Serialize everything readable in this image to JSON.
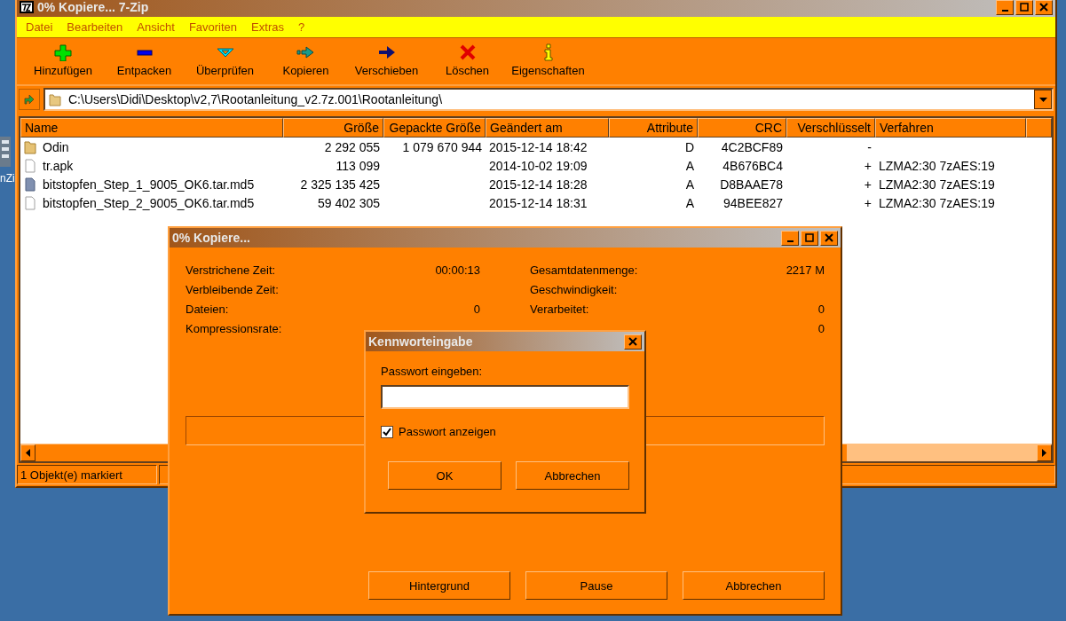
{
  "desktop_icons": [
    {
      "label": "nZi"
    }
  ],
  "main_window": {
    "title": "0% Kopiere... 7-Zip",
    "menu": [
      "Datei",
      "Bearbeiten",
      "Ansicht",
      "Favoriten",
      "Extras",
      "?"
    ],
    "toolbar": [
      {
        "label": "Hinzufügen",
        "kind": "add"
      },
      {
        "label": "Entpacken",
        "kind": "extract"
      },
      {
        "label": "Überprüfen",
        "kind": "test"
      },
      {
        "label": "Kopieren",
        "kind": "copy"
      },
      {
        "label": "Verschieben",
        "kind": "move"
      },
      {
        "label": "Löschen",
        "kind": "delete"
      },
      {
        "label": "Eigenschaften",
        "kind": "info"
      }
    ],
    "address": "C:\\Users\\Didi\\Desktop\\v2,7\\Rootanleitung_v2.7z.001\\Rootanleitung\\",
    "table": {
      "columns": [
        "Name",
        "Größe",
        "Gepackte Größe",
        "Geändert am",
        "Attribute",
        "CRC",
        "Verschlüsselt",
        "Verfahren"
      ],
      "rows": [
        {
          "kind": "folder",
          "cells": [
            "Odin",
            "2 292 055",
            "1 079 670 944",
            "2015-12-14 18:42",
            "D",
            "4C2BCF89",
            "-",
            ""
          ]
        },
        {
          "kind": "file",
          "cells": [
            "tr.apk",
            "113 099",
            "",
            "2014-10-02 19:09",
            "A",
            "4B676BC4",
            "+",
            "LZMA2:30 7zAES:19"
          ]
        },
        {
          "kind": "file-filled",
          "cells": [
            "bitstopfen_Step_1_9005_OK6.tar.md5",
            "2 325 135 425",
            "",
            "2015-12-14 18:28",
            "A",
            "D8BAAE78",
            "+",
            "LZMA2:30 7zAES:19"
          ]
        },
        {
          "kind": "file",
          "cells": [
            "bitstopfen_Step_2_9005_OK6.tar.md5",
            "59 402 305",
            "",
            "2015-12-14 18:31",
            "A",
            "94BEE827",
            "+",
            "LZMA2:30 7zAES:19"
          ]
        }
      ]
    },
    "status_bar": [
      "1 Objekt(e) markiert"
    ]
  },
  "progress_dialog": {
    "title": "0% Kopiere...",
    "stats_left": [
      {
        "label": "Verstrichene Zeit:",
        "value": "00:00:13"
      },
      {
        "label": "Verbleibende Zeit:"
      },
      {
        "label": "Dateien:",
        "value": "0"
      },
      {
        "label": "Kompressionsrate:"
      }
    ],
    "stats_right": [
      {
        "label": "Gesamtdatenmenge:",
        "value": "2217 M"
      },
      {
        "label": "Geschwindigkeit:"
      },
      {
        "label": "Verarbeitet:",
        "value": "0"
      },
      {
        "value": "0"
      }
    ],
    "level": 0,
    "buttons": [
      "Hintergrund",
      "Pause",
      "Abbrechen"
    ]
  },
  "password_dialog": {
    "title": "Kennworteingabe",
    "prompt": "Passwort eingeben:",
    "show_password": {
      "label": "Passwort anzeigen",
      "checked": true
    },
    "buttons": [
      "OK",
      "Abbrechen"
    ]
  }
}
